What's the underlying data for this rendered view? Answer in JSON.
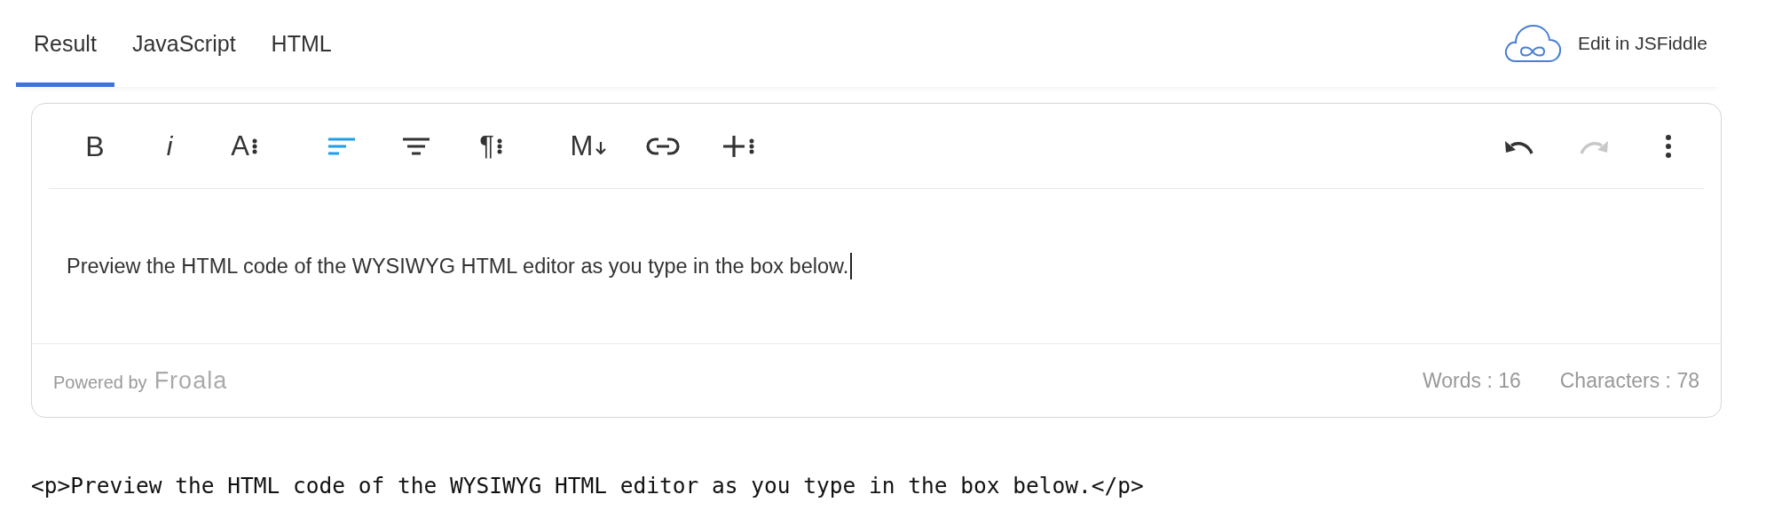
{
  "tabs": [
    {
      "label": "Result",
      "selected": true
    },
    {
      "label": "JavaScript",
      "selected": false
    },
    {
      "label": "HTML",
      "selected": false
    }
  ],
  "edit_link": {
    "label": "Edit in JSFiddle"
  },
  "toolbar": {
    "groups": [
      [
        {
          "kind": "bold",
          "glyph": "B",
          "selected": false,
          "disabled": false
        },
        {
          "kind": "italic",
          "glyph": "i",
          "selected": false,
          "disabled": false
        },
        {
          "kind": "font-size",
          "glyph": "A",
          "selected": false,
          "disabled": false
        }
      ],
      [
        {
          "kind": "align-left",
          "selected": true,
          "disabled": false
        },
        {
          "kind": "align-center",
          "selected": false,
          "disabled": false
        },
        {
          "kind": "paragraph",
          "glyph": "¶",
          "selected": false,
          "disabled": false
        }
      ],
      [
        {
          "kind": "markdown",
          "glyph": "M",
          "selected": false,
          "disabled": false
        },
        {
          "kind": "link",
          "selected": false,
          "disabled": false
        },
        {
          "kind": "insert",
          "selected": false,
          "disabled": false
        }
      ]
    ],
    "right": [
      {
        "kind": "undo",
        "disabled": false
      },
      {
        "kind": "redo",
        "disabled": true
      },
      {
        "kind": "more",
        "disabled": false
      }
    ]
  },
  "content": "Preview the HTML code of the WYSIWYG HTML editor as you type in the box below.",
  "footer": {
    "powered_by": "Powered by",
    "brand": "Froala",
    "words": "Words : 16",
    "characters": "Characters : 78"
  },
  "html_output": "<p>Preview the HTML code of the WYSIWYG HTML editor as you type in the box below.</p>"
}
